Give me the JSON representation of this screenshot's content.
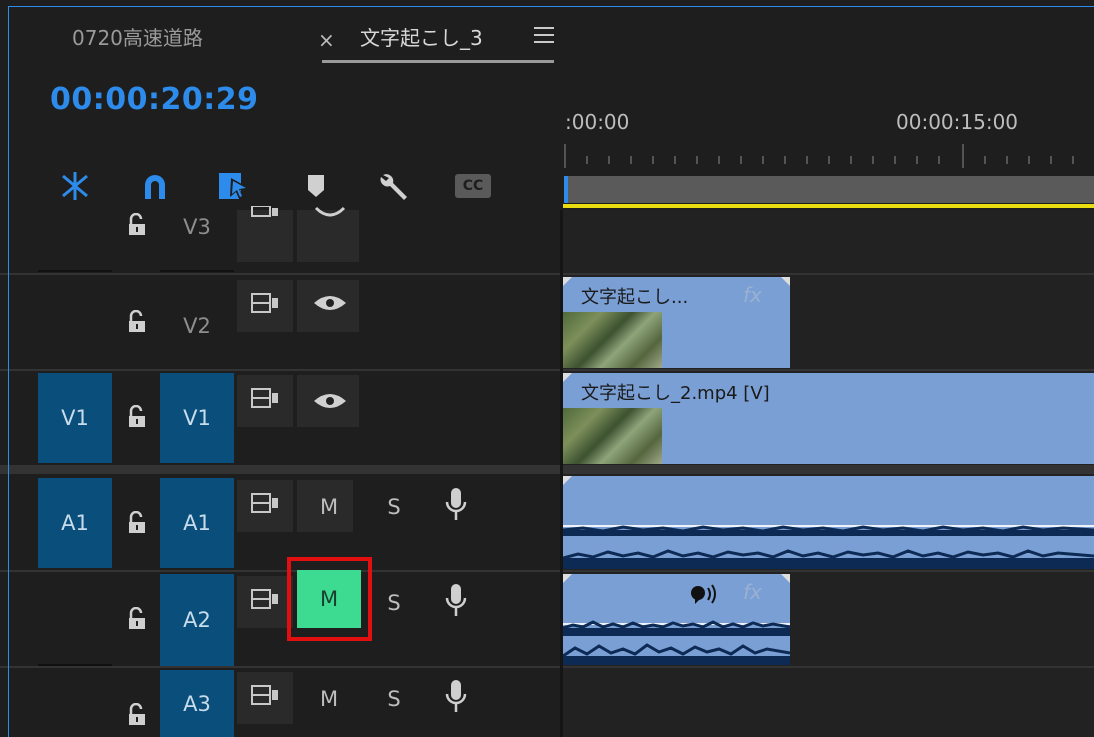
{
  "tabs": [
    {
      "label": "0720高速道路",
      "active": false
    },
    {
      "label": "文字起こし_3",
      "active": true
    }
  ],
  "close_glyph": "×",
  "timecode": "00:00:20:29",
  "ruler": {
    "start": ":00:00",
    "mid": "00:00:15:00"
  },
  "tools": [
    "nest-icon",
    "snap-magnet-icon",
    "linked-selection-icon",
    "marker-icon",
    "wrench-icon",
    "captions-icon"
  ],
  "captions_label": "CC",
  "tracks": {
    "v3": {
      "target": "V3"
    },
    "v2": {
      "target": "V2"
    },
    "v1": {
      "source": "V1",
      "target": "V1"
    },
    "a1": {
      "source": "A1",
      "target": "A1",
      "mute": "M",
      "solo": "S"
    },
    "a2": {
      "target": "A2",
      "mute": "M",
      "solo": "S"
    },
    "a3": {
      "target": "A3",
      "mute": "M",
      "solo": "S"
    }
  },
  "clips": {
    "v2": {
      "name": "文字起こし...",
      "fx": "fx"
    },
    "v1": {
      "name": "文字起こし_2.mp4 [V]"
    },
    "a2": {
      "fx": "fx"
    }
  },
  "colors": {
    "accent": "#2d8ceb",
    "mute_active": "#3ddb91",
    "highlight": "#e10f0f",
    "clip": "#7a9fd4",
    "track_patch": "#0a4f7b"
  }
}
